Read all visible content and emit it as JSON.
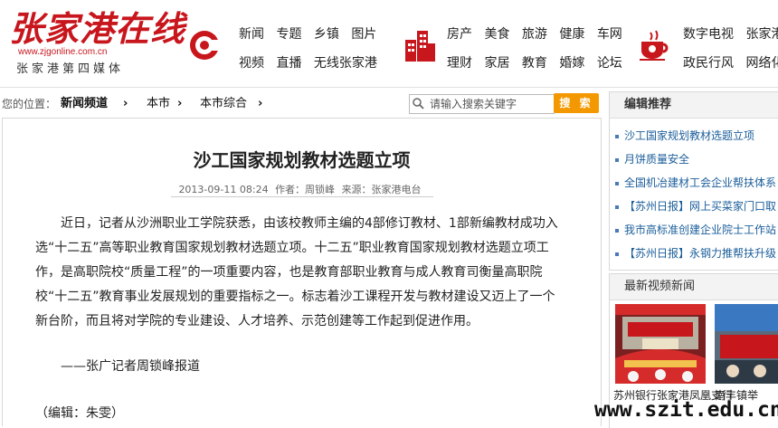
{
  "header": {
    "logo_title": "张家港在线",
    "logo_url": "www.zjgonline.com.cn",
    "logo_tagline": "张家港第四媒体",
    "nav_groups": [
      {
        "icon": "c-logo-icon",
        "row1": [
          "新闻",
          "专题",
          "乡镇",
          "图片"
        ],
        "row2": [
          "视频",
          "直播",
          "无线张家港"
        ]
      },
      {
        "icon": "buildings-icon",
        "row1": [
          "房产",
          "美食",
          "旅游",
          "健康",
          "车网"
        ],
        "row2": [
          "理财",
          "家居",
          "教育",
          "婚嫁",
          "论坛"
        ]
      },
      {
        "icon": "coffee-cup-icon",
        "row1": [
          "数字电视",
          "张家港"
        ],
        "row2": [
          "政民行风",
          "网络化"
        ]
      }
    ]
  },
  "breadcrumb": {
    "prefix": "您的位置：",
    "items": [
      "新闻频道",
      "本市",
      "本市综合"
    ]
  },
  "search": {
    "placeholder": "请输入搜索关键字",
    "button_label": "搜 索"
  },
  "article": {
    "title": "沙工国家规划教材选题立项",
    "date": "2013-09-11 08:24",
    "author": "作者：周锁峰",
    "source": "来源：张家港电台",
    "body": "近日，记者从沙洲职业工学院获悉，由该校教师主编的4部修订教材、1部新编教材成功入选“十二五”高等职业教育国家规划教材选题立项。十二五”职业教育国家规划教材选题立项工作，是高职院校“质量工程”的一项重要内容，也是教育部职业教育与成人教育司衡量高职院校“十二五”教育事业发展规划的重要指标之一。标志着沙工课程开发与教材建设又迈上了一个新台阶，而且将对学院的专业建设、人才培养、示范创建等工作起到促进作用。",
    "byline": "——张广记者周锁峰报道",
    "editor": "（编辑：朱雯）"
  },
  "sidebar": {
    "recommend_title": "编辑推荐",
    "recommend_items": [
      "沙工国家规划教材选题立项",
      "月饼质量安全",
      "全国机冶建材工会企业帮扶体系",
      "【苏州日报】网上买菜家门口取",
      "我市高标准创建企业院士工作站",
      "【苏州日报】永钢力推帮扶升级"
    ],
    "video_title": "最新视频新闻",
    "video_captions": [
      "苏州银行张家港凤凰支行",
      "南丰镇举"
    ]
  },
  "watermark": "www.szit.edu.cn",
  "colors": {
    "brand_red": "#c8161d",
    "search_orange": "#f39800",
    "link_blue": "#1b5e9a"
  }
}
